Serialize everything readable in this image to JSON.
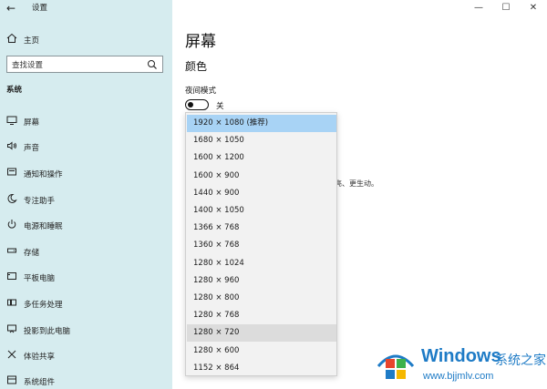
{
  "window": {
    "title": "设置",
    "controls": {
      "minimize": "—",
      "maximize": "☐",
      "close": "✕"
    }
  },
  "sidebar": {
    "home_label": "主页",
    "search": {
      "placeholder": "查找设置"
    },
    "section_label": "系统",
    "items": [
      {
        "label": "屏幕",
        "icon": "monitor-icon"
      },
      {
        "label": "声音",
        "icon": "speaker-icon"
      },
      {
        "label": "通知和操作",
        "icon": "notification-icon"
      },
      {
        "label": "专注助手",
        "icon": "moon-icon"
      },
      {
        "label": "电源和睡眠",
        "icon": "power-icon"
      },
      {
        "label": "存储",
        "icon": "storage-icon"
      },
      {
        "label": "平板电脑",
        "icon": "tablet-icon"
      },
      {
        "label": "多任务处理",
        "icon": "multitask-icon"
      },
      {
        "label": "投影到此电脑",
        "icon": "project-icon"
      },
      {
        "label": "体验共享",
        "icon": "share-icon"
      },
      {
        "label": "系统组件",
        "icon": "components-icon"
      }
    ]
  },
  "main": {
    "page_title": "屏幕",
    "sub_title": "颜色",
    "night_mode_label": "夜间模式",
    "night_mode_state": "关",
    "partial_text": "亮、更生动。"
  },
  "resolution_dropdown": {
    "selected_index": 0,
    "hover_index": 12,
    "options": [
      "1920 × 1080 (推荐)",
      "1680 × 1050",
      "1600 × 1200",
      "1600 × 900",
      "1440 × 900",
      "1400 × 1050",
      "1366 × 768",
      "1360 × 768",
      "1280 × 1024",
      "1280 × 960",
      "1280 × 800",
      "1280 × 768",
      "1280 × 720",
      "1280 × 600",
      "1152 × 864"
    ]
  },
  "watermark": {
    "brand": "Windows",
    "cn_text": "系统之家",
    "url": "www.bjjmlv.com"
  },
  "colors": {
    "sidebar_bg": "#d6ecef",
    "selected_bg": "#a8d3f5",
    "hover_bg": "#dcdcdc",
    "watermark_blue": "#1e7bc6"
  }
}
